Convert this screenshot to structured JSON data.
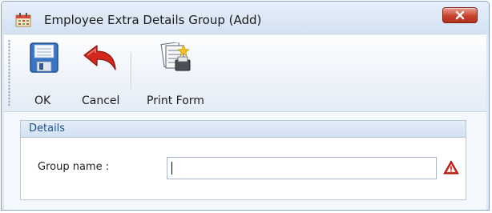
{
  "window": {
    "title": "Employee Extra Details Group (Add)",
    "app_icon": "calendar-icon",
    "close_icon": "close-icon"
  },
  "toolbar": {
    "ok_label": "OK",
    "ok_icon": "save-disk-icon",
    "cancel_label": "Cancel",
    "cancel_icon": "undo-arrow-icon",
    "print_label": "Print Form",
    "print_icon": "print-form-icon"
  },
  "details": {
    "section_title": "Details",
    "group_name_label": "Group name :",
    "group_name_value": "",
    "warning_icon": "warning-icon"
  },
  "colors": {
    "close_button": "#c7432f",
    "section_title": "#1d4f91",
    "warning": "#d9261c",
    "cancel_arrow": "#d4281f"
  }
}
